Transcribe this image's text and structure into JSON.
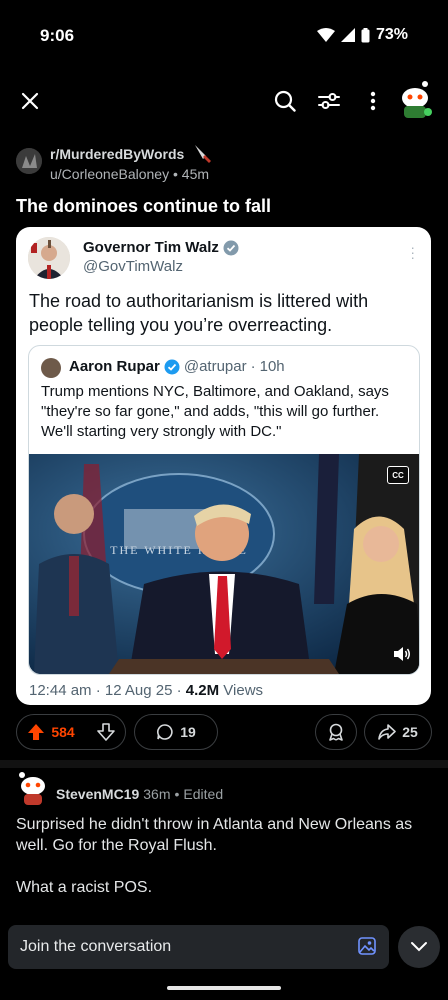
{
  "status_bar": {
    "time": "9:06",
    "battery": "73%"
  },
  "top_bar": {
    "close_icon": "close-icon",
    "search_icon": "search-icon",
    "filter_icon": "sort-filter-icon",
    "more_icon": "more-vertical-icon"
  },
  "post": {
    "subreddit": "r/MurderedByWords",
    "author": "u/CorleoneBaloney",
    "age": "45m",
    "title": "The dominoes continue to fall",
    "embed": {
      "name": "Governor Tim Walz",
      "handle": "@GovTimWalz",
      "text": "The road to authoritarianism is littered with people telling you you’re overreacting.",
      "quote": {
        "name": "Aaron Rupar",
        "handle": "@atrupar",
        "age": "10h",
        "text": "Trump mentions NYC, Baltimore, and Oakland, says \"they're so far gone,\" and adds, \"this will go further. We'll starting very strongly with DC.\"",
        "cc_label": "CC"
      },
      "time_date": "12:44 am · 12 Aug 25 · ",
      "views_count": "4.2M",
      "views_label": " Views"
    },
    "upvotes": "584",
    "comments": "19",
    "shares": "25"
  },
  "comment": {
    "user": "StevenMC19",
    "age": "36m",
    "edited": "Edited",
    "lines": [
      "Surprised he didn't throw in Atlanta and New Orleans as well. Go for the Royal Flush.",
      "What a racist POS."
    ]
  },
  "bottom_bar": {
    "placeholder": "Join the conversation"
  },
  "colors": {
    "upvote": "#ff4500",
    "background": "#000000",
    "verified": "#1d9bf0"
  }
}
